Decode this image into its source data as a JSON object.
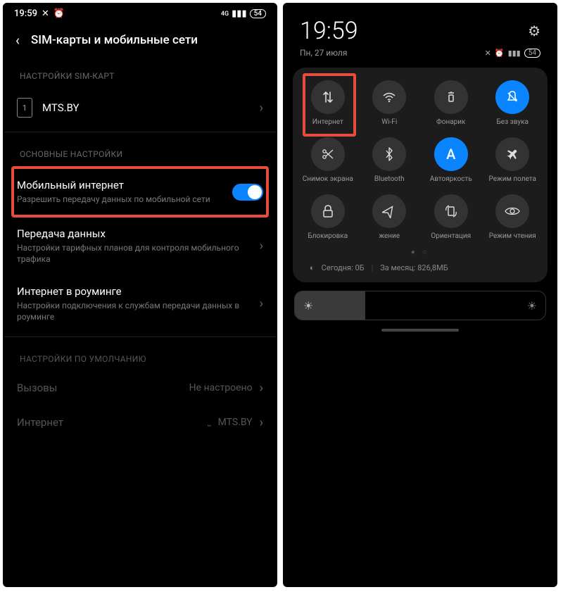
{
  "left": {
    "status": {
      "time": "19:59",
      "battery": "54"
    },
    "header_title": "SIM-карты и мобильные сети",
    "sections": {
      "sim_settings_label": "НАСТРОЙКИ SIM-КАРТ",
      "sim_slot": "1",
      "sim_name": "MTS.BY",
      "main_settings_label": "ОСНОВНЫЕ НАСТРОЙКИ",
      "mobile_internet": {
        "title": "Мобильный интернет",
        "sub": "Разрешить передачу данных по мобильной сети"
      },
      "data_usage": {
        "title": "Передача данных",
        "sub": "Настройки тарифных планов для контроля мобильного трафика"
      },
      "roaming": {
        "title": "Интернет в роуминге",
        "sub": "Настройки подключения к службам передачи данных в роуминге"
      },
      "defaults_label": "НАСТРОЙКИ ПО УМОЛЧАНИЮ",
      "calls": {
        "title": "Вызовы",
        "value": "Не настроено"
      },
      "internet": {
        "title": "Интернет",
        "value": "MTS.BY"
      }
    }
  },
  "right": {
    "clock": "19:59",
    "date": "Пн, 27 июля",
    "battery": "54",
    "tiles": [
      {
        "label": "Интернет",
        "on": false,
        "icon": "data"
      },
      {
        "label": "Wi-Fi",
        "on": false,
        "icon": "wifi"
      },
      {
        "label": "Фонарик",
        "on": false,
        "icon": "torch"
      },
      {
        "label": "Без звука",
        "on": true,
        "icon": "mute"
      },
      {
        "label": "Снимок экрана",
        "on": false,
        "icon": "scissors"
      },
      {
        "label": "Bluetooth",
        "on": false,
        "icon": "bt"
      },
      {
        "label": "Автояркость",
        "on": true,
        "icon": "autob"
      },
      {
        "label": "Режим полета",
        "on": false,
        "icon": "plane"
      },
      {
        "label": "Блокировка",
        "on": false,
        "icon": "lock"
      },
      {
        "label": "жение",
        "on": false,
        "icon": "nav"
      },
      {
        "label": "Ориентация",
        "on": false,
        "icon": "orient"
      },
      {
        "label": "Режим чтения",
        "on": false,
        "icon": "eye"
      }
    ],
    "usage": {
      "today_label": "Сегодня: 0Б",
      "month_label": "За месяц: 826,8МБ"
    }
  }
}
